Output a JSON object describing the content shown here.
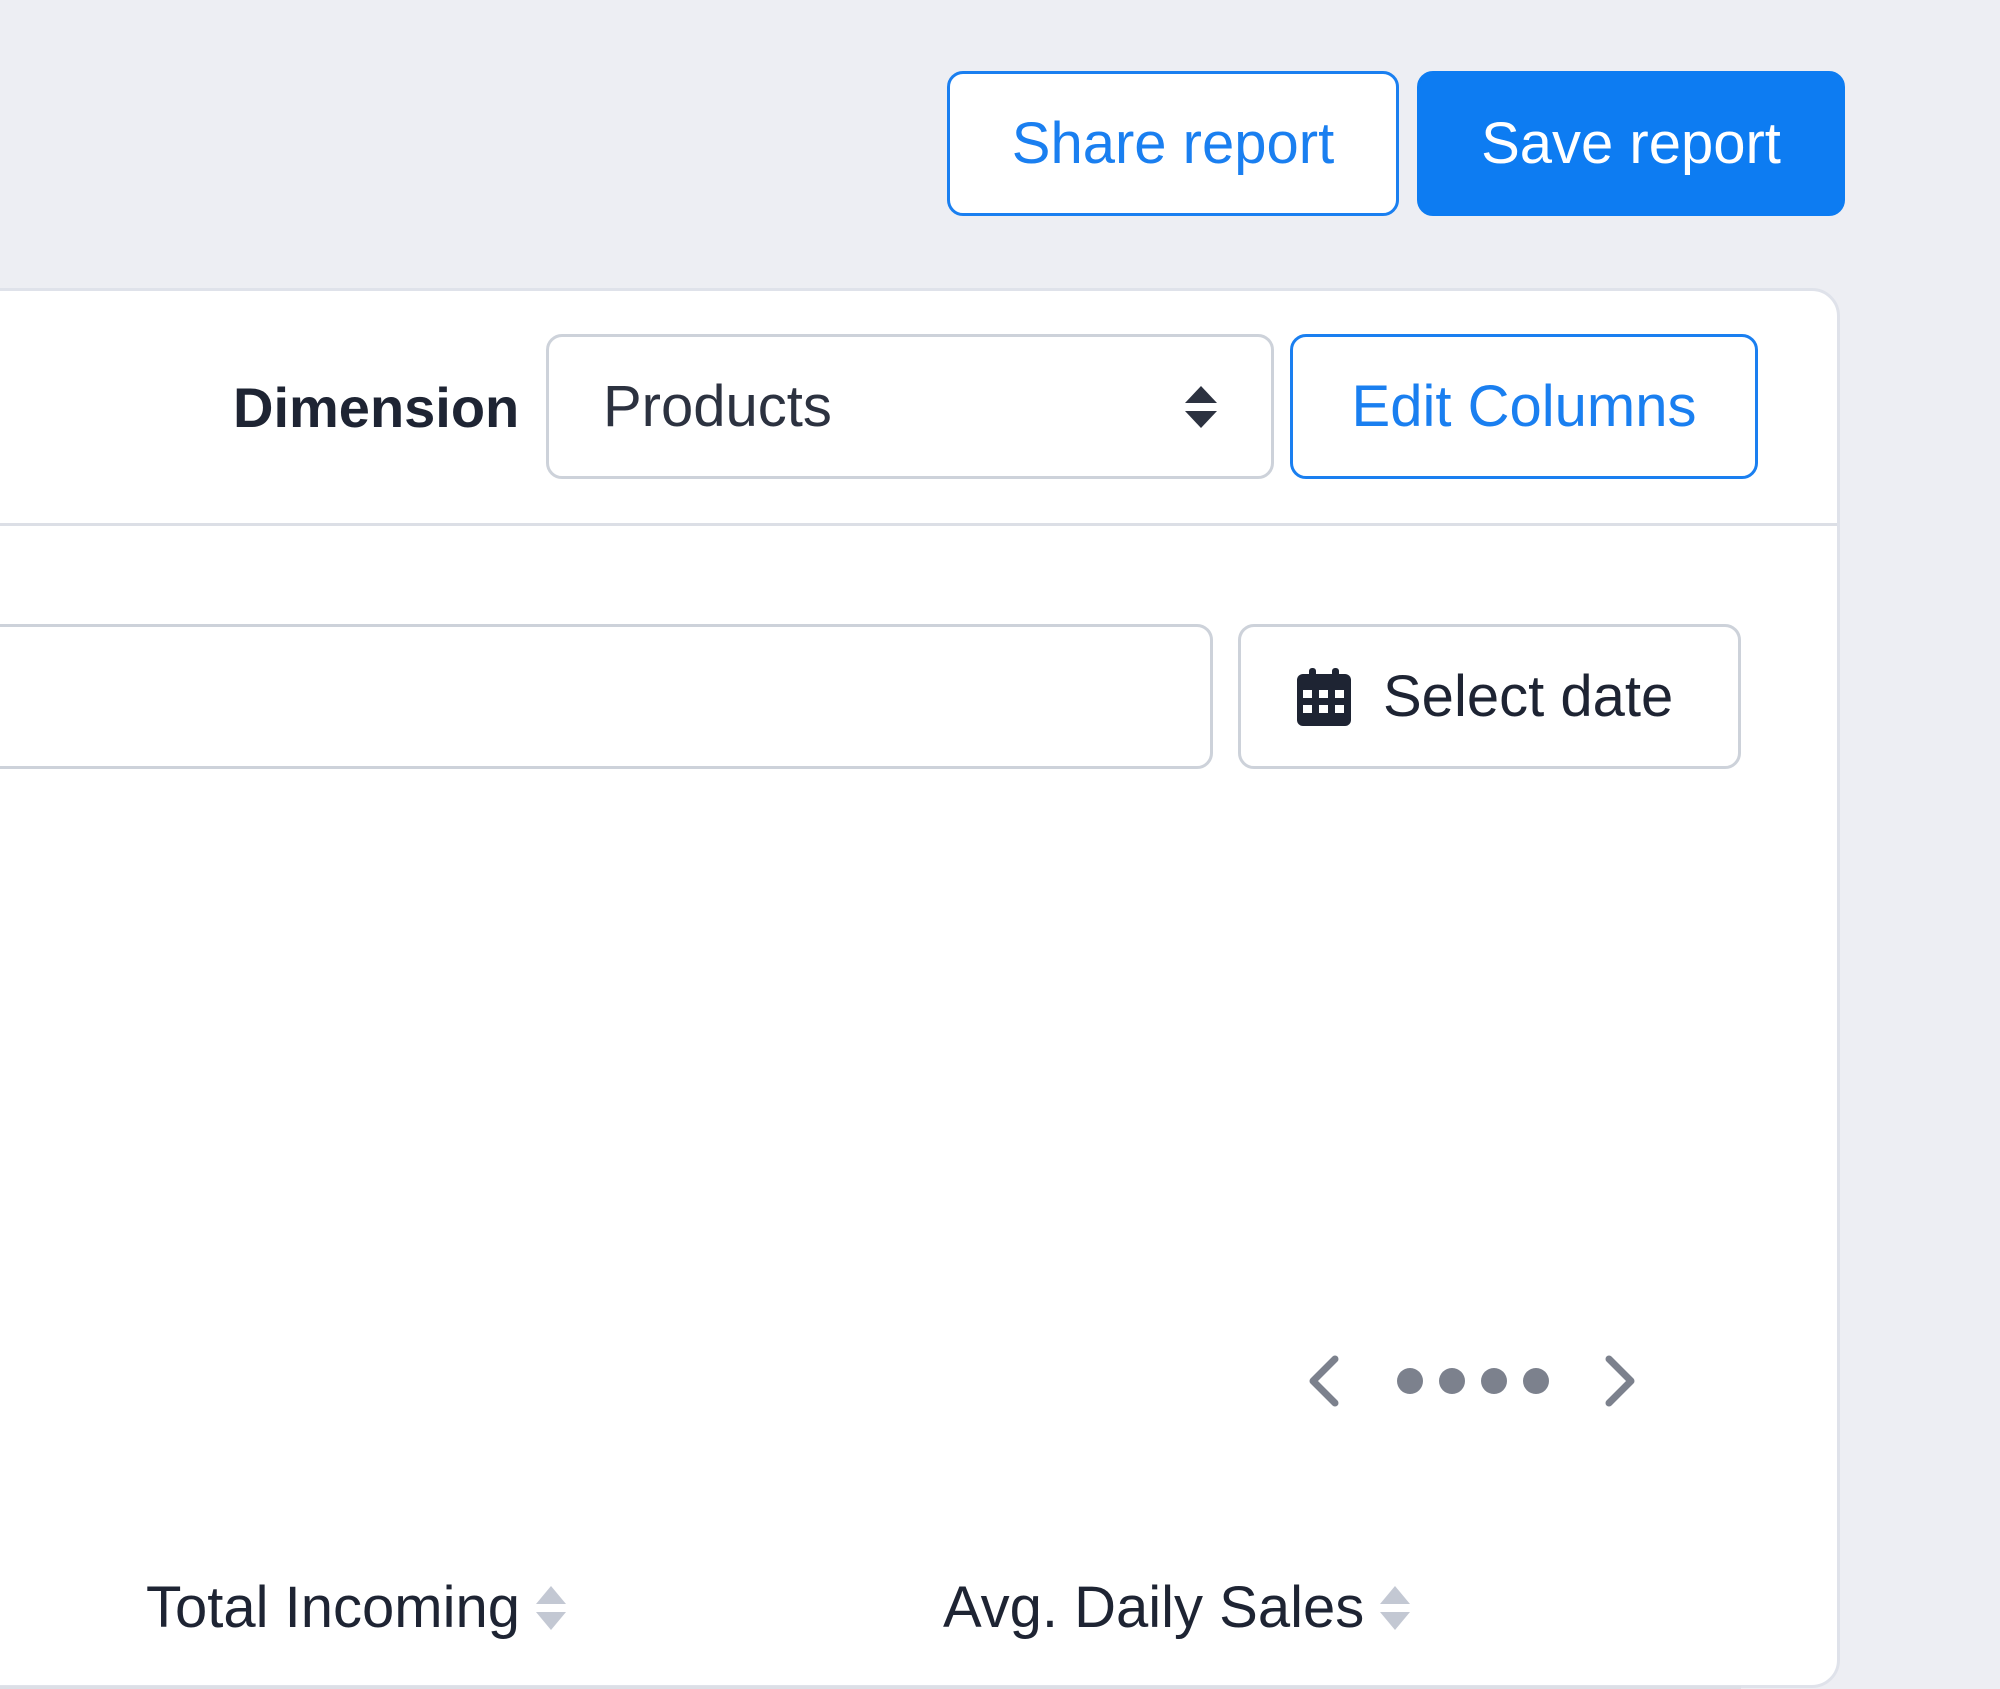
{
  "header": {
    "share_label": "Share report",
    "save_label": "Save report"
  },
  "toolbar": {
    "dimension_label": "Dimension",
    "dimension_value": "Products",
    "edit_columns_label": "Edit Columns"
  },
  "filters": {
    "search_value": "",
    "search_placeholder": "",
    "date_label": "Select date"
  },
  "pagination": {
    "page_count": 4
  },
  "table": {
    "columns": [
      {
        "label": "Total Incoming"
      },
      {
        "label": "Avg. Daily Sales"
      }
    ]
  },
  "colors": {
    "accent": "#0d7cf2",
    "background": "#edeef3",
    "border": "#cdd2da",
    "text": "#1e2433",
    "muted": "#7c818d",
    "sort_icon": "#c3c8d3"
  }
}
